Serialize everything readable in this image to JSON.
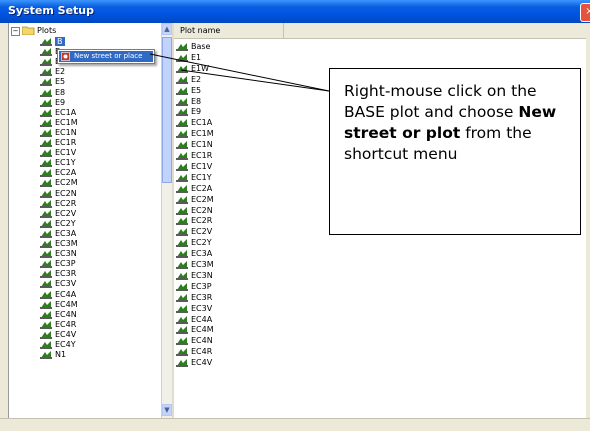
{
  "window": {
    "title": "System Setup",
    "close_label": "×"
  },
  "tree": {
    "root_label": "Plots",
    "selected_label": "B",
    "items": [
      "E",
      "E1W",
      "E2",
      "E5",
      "E8",
      "E9",
      "EC1A",
      "EC1M",
      "EC1N",
      "EC1R",
      "EC1V",
      "EC1Y",
      "EC2A",
      "EC2M",
      "EC2N",
      "EC2R",
      "EC2V",
      "EC2Y",
      "EC3A",
      "EC3M",
      "EC3N",
      "EC3P",
      "EC3R",
      "EC3V",
      "EC4A",
      "EC4M",
      "EC4N",
      "EC4R",
      "EC4V",
      "EC4Y",
      "N1"
    ]
  },
  "context_menu": {
    "item_label": "New street or place"
  },
  "list": {
    "column_header": "Plot name",
    "items": [
      "Base",
      "E1",
      "E1W",
      "E2",
      "E5",
      "E8",
      "E9",
      "EC1A",
      "EC1M",
      "EC1N",
      "EC1R",
      "EC1V",
      "EC1Y",
      "EC2A",
      "EC2M",
      "EC2N",
      "EC2R",
      "EC2V",
      "EC2Y",
      "EC3A",
      "EC3M",
      "EC3N",
      "EC3P",
      "EC3R",
      "EC3V",
      "EC4A",
      "EC4M",
      "EC4N",
      "EC4R",
      "EC4V"
    ]
  },
  "callout": {
    "line1": "Right-mouse click on the BASE plot and choose ",
    "bold": "New street or plot",
    "line2": " from the shortcut menu"
  },
  "colors": {
    "titlebar": "#0054e3",
    "selection": "#316ac5",
    "icon_green": "#2e7d1f"
  }
}
